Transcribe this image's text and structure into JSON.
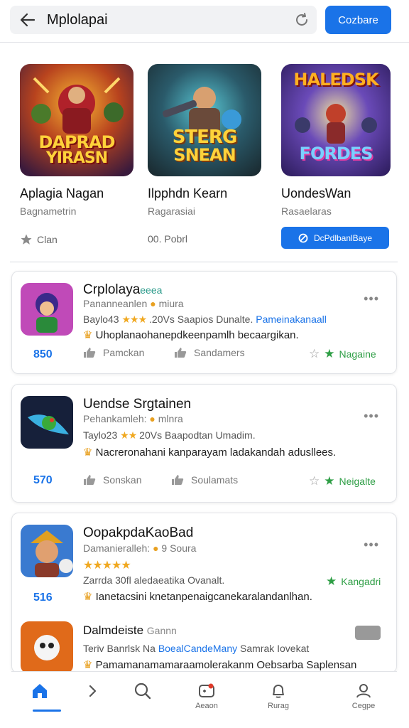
{
  "top_bar": {
    "search_value": "Mplolapai",
    "button_label": "Cozbare"
  },
  "featured": [
    {
      "art_text": [
        "DAPRAD",
        "YIRASN"
      ],
      "title": "Aplagia Nagan",
      "subtitle": "Bagnametrin",
      "meta": "Clan"
    },
    {
      "art_text": [
        "STERG",
        "SNEAN"
      ],
      "title": "Ilpphdn Kearn",
      "subtitle": "Ragarasiai",
      "meta": "00. Pobrl"
    },
    {
      "art_text": [
        "HALEDSK",
        "FORDES"
      ],
      "title": "UondesWan",
      "subtitle": "Rasaelaras",
      "button_label": "DcPdlbanlBaye"
    }
  ],
  "cards": [
    {
      "title": "Crplolaya",
      "title_suffix": "eeea",
      "subtitle": "Pananneanlen",
      "subtitle_suffix": "miura",
      "rating_prefix": "Baylo43",
      "rating_text": ".20Vs Saapios Dunalte.",
      "rating_link": "Pameinakanaall",
      "description": "Uhoplanaohanepdkeenpamlh becaargikan.",
      "number": "850",
      "action_1": "Pamckan",
      "action_2": "Sandamers",
      "action_3": "Nagaine"
    },
    {
      "title": "Uendse Srgtainen",
      "subtitle": "Pehankamleh:",
      "subtitle_suffix": "mlnra",
      "rating_prefix": "Taylo23",
      "rating_text": "20Vs Baapodtan Umadim.",
      "description": "Nacreronahani kanparayam ladakandah adusllees.",
      "number": "570",
      "action_1": "Sonskan",
      "action_2": "Soulamats",
      "action_3": "Neigalte"
    },
    {
      "title": "OopakpdaKaoBad",
      "subtitle": "Damanieralleh:",
      "subtitle_suffix": "9 Soura",
      "rating_text": "Zarrda 30fl aledaeatika Ovanalt.",
      "description": "Ianetacsini knetanpenaigcanekaralandanlhan.",
      "number": "516",
      "action_3": "Kangadri"
    },
    {
      "title": "Dalmdeiste",
      "title_suffix": "Gannn",
      "rating_prefix": "Teriv Banrlsk Na",
      "rating_link": "BoealCandeMany",
      "rating_text": "Samrak Iovekat",
      "description": "Pamamanamamaraamolerakanm Oebsarba Saplensan"
    }
  ],
  "bottom_nav": [
    {
      "label": ""
    },
    {
      "label": ""
    },
    {
      "label": ""
    },
    {
      "label": "Aeaon"
    },
    {
      "label": "Rurag"
    },
    {
      "label": "Cegpe"
    }
  ],
  "colors": {
    "accent": "#1a73e8",
    "green": "#2e9e45",
    "star": "#f0a820"
  }
}
